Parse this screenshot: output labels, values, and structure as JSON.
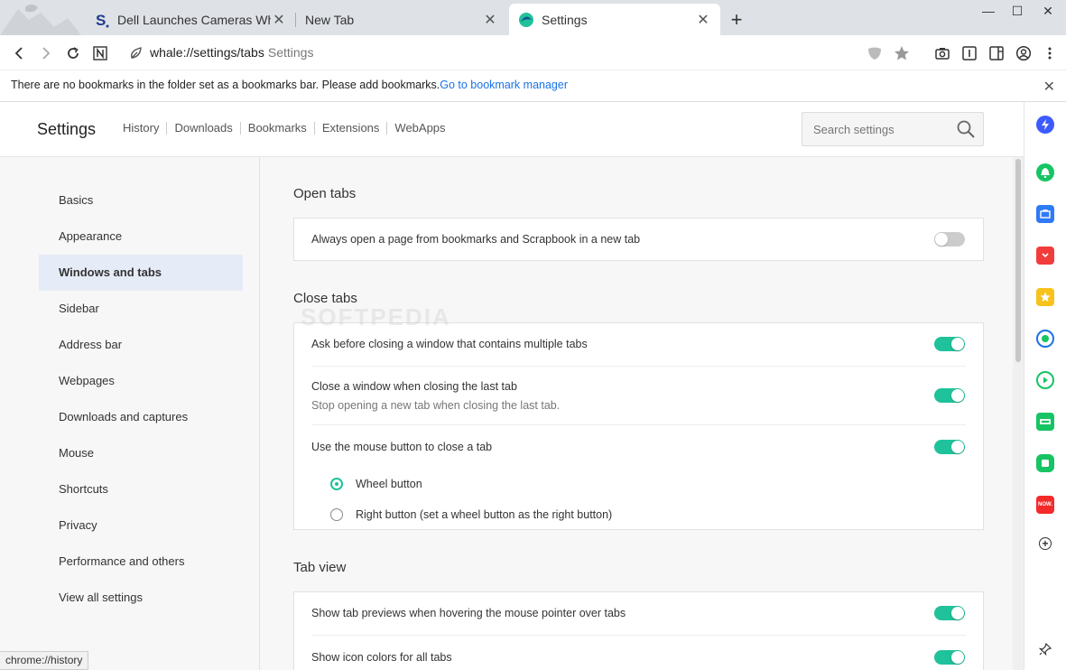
{
  "tabs": [
    {
      "title": "Dell Launches Cameras Whose"
    },
    {
      "title": "New Tab"
    },
    {
      "title": "Settings"
    }
  ],
  "toolbar": {
    "url": "whale://settings/tabs",
    "url_sub": "Settings"
  },
  "bookmarkbar": {
    "message": "There are no bookmarks in the folder set as a bookmarks bar. Please add bookmarks.",
    "link": "Go to bookmark manager"
  },
  "header": {
    "title": "Settings",
    "nav": [
      "History",
      "Downloads",
      "Bookmarks",
      "Extensions",
      "WebApps"
    ],
    "search_placeholder": "Search settings"
  },
  "left_nav": {
    "items": [
      "Basics",
      "Appearance",
      "Windows and tabs",
      "Sidebar",
      "Address bar",
      "Webpages",
      "Downloads and captures",
      "Mouse",
      "Shortcuts",
      "Privacy",
      "Performance and others",
      "View all settings"
    ],
    "active_index": 2
  },
  "sections": {
    "open_tabs": {
      "title": "Open tabs",
      "row1": "Always open a page from bookmarks and Scrapbook in a new tab"
    },
    "close_tabs": {
      "title": "Close tabs",
      "row1": "Ask before closing a window that contains multiple tabs",
      "row2": "Close a window when closing the last tab",
      "row2_desc": "Stop opening a new tab when closing the last tab.",
      "row3": "Use the mouse button to close a tab",
      "radio1": "Wheel button",
      "radio2": "Right button (set a wheel button as the right button)"
    },
    "tab_view": {
      "title": "Tab view",
      "row1": "Show tab previews when hovering the mouse pointer over tabs",
      "row2": "Show icon colors for all tabs"
    }
  },
  "statusbar": "chrome://history",
  "watermark": "SOFTPEDIA",
  "sidebar_badge": "NOW.",
  "colors": {
    "accent": "#1fc29b",
    "link": "#1a73e8",
    "active_nav_bg": "#e5ecf7"
  }
}
